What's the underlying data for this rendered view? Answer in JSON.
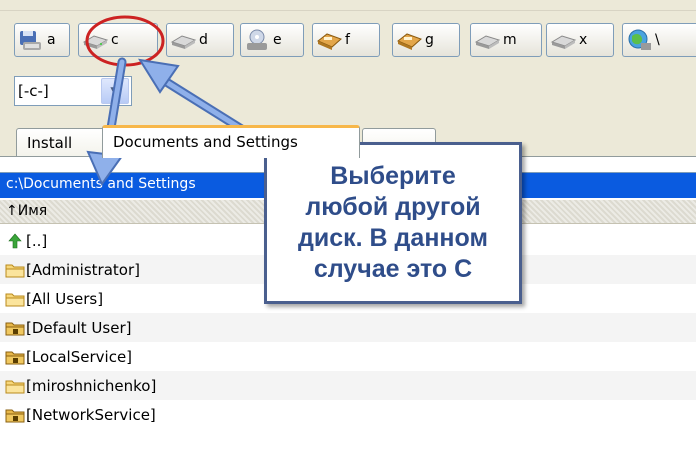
{
  "toolbar": {
    "drives": [
      {
        "label": "a",
        "icon": "floppy-drive-icon"
      },
      {
        "label": "c",
        "icon": "hard-drive-icon"
      },
      {
        "label": "d",
        "icon": "hard-drive-icon"
      },
      {
        "label": "e",
        "icon": "cd-drive-icon"
      },
      {
        "label": "f",
        "icon": "removable-drive-icon"
      },
      {
        "label": "g",
        "icon": "removable-drive-icon"
      },
      {
        "label": "m",
        "icon": "hard-drive-icon"
      },
      {
        "label": "x",
        "icon": "hard-drive-icon"
      },
      {
        "label": "\\",
        "icon": "network-icon"
      }
    ]
  },
  "combo": {
    "value": "[-c-]"
  },
  "tabs": [
    {
      "label": "Install"
    },
    {
      "label": "Documents and Settings"
    },
    {
      "label": "..."
    }
  ],
  "path": "c:\\Documents and Settings",
  "header": {
    "name_column": "↑Имя"
  },
  "files": [
    {
      "name": "[..]",
      "icon": "up-arrow-icon"
    },
    {
      "name": "[Administrator]",
      "icon": "folder-icon"
    },
    {
      "name": "[All Users]",
      "icon": "folder-icon"
    },
    {
      "name": "[Default User]",
      "icon": "locked-folder-icon"
    },
    {
      "name": "[LocalService]",
      "icon": "locked-folder-icon"
    },
    {
      "name": "[miroshnichenko]",
      "icon": "folder-icon"
    },
    {
      "name": "[NetworkService]",
      "icon": "locked-folder-icon"
    }
  ],
  "callout": {
    "text": "Выберите\nлюбой другой\nдиск. В данном\nслучае это C"
  },
  "colors": {
    "accent": "#0a5be0",
    "callout_border": "#4a5f8e",
    "callout_text": "#2f4d8a",
    "arrow": "#6b8fd0",
    "circle": "#cc2222"
  }
}
